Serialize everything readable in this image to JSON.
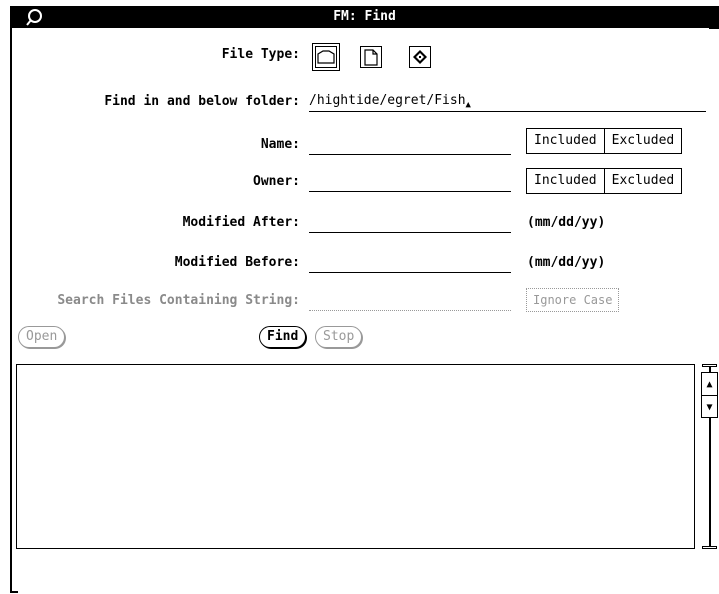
{
  "window": {
    "title": "FM: Find"
  },
  "file_type": {
    "label": "File Type:",
    "icons": [
      "folder-icon",
      "document-icon",
      "application-icon"
    ]
  },
  "folder": {
    "label": "Find in and below folder:",
    "value": "/hightide/egret/Fish"
  },
  "name": {
    "label": "Name:",
    "value": "",
    "included": "Included",
    "excluded": "Excluded"
  },
  "owner": {
    "label": "Owner:",
    "value": "",
    "included": "Included",
    "excluded": "Excluded"
  },
  "modified_after": {
    "label": "Modified After:",
    "value": "",
    "hint": "(mm/dd/yy)"
  },
  "modified_before": {
    "label": "Modified Before:",
    "value": "",
    "hint": "(mm/dd/yy)"
  },
  "search_string": {
    "label": "Search Files Containing String:",
    "value": "",
    "ignore_case": "Ignore Case"
  },
  "buttons": {
    "open": "Open",
    "find": "Find",
    "stop": "Stop"
  },
  "colors": {
    "titlebar": "#000000",
    "disabled": "#999999"
  }
}
